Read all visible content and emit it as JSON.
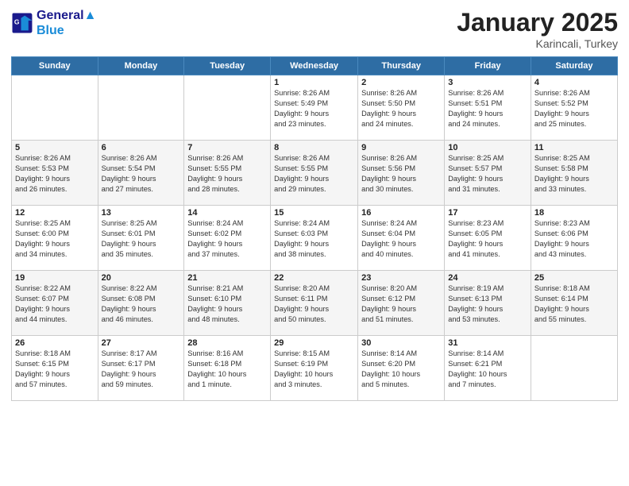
{
  "logo": {
    "line1": "General",
    "line2": "Blue"
  },
  "title": "January 2025",
  "location": "Karincali, Turkey",
  "days_header": [
    "Sunday",
    "Monday",
    "Tuesday",
    "Wednesday",
    "Thursday",
    "Friday",
    "Saturday"
  ],
  "weeks": [
    [
      {
        "num": "",
        "info": ""
      },
      {
        "num": "",
        "info": ""
      },
      {
        "num": "",
        "info": ""
      },
      {
        "num": "1",
        "info": "Sunrise: 8:26 AM\nSunset: 5:49 PM\nDaylight: 9 hours\nand 23 minutes."
      },
      {
        "num": "2",
        "info": "Sunrise: 8:26 AM\nSunset: 5:50 PM\nDaylight: 9 hours\nand 24 minutes."
      },
      {
        "num": "3",
        "info": "Sunrise: 8:26 AM\nSunset: 5:51 PM\nDaylight: 9 hours\nand 24 minutes."
      },
      {
        "num": "4",
        "info": "Sunrise: 8:26 AM\nSunset: 5:52 PM\nDaylight: 9 hours\nand 25 minutes."
      }
    ],
    [
      {
        "num": "5",
        "info": "Sunrise: 8:26 AM\nSunset: 5:53 PM\nDaylight: 9 hours\nand 26 minutes."
      },
      {
        "num": "6",
        "info": "Sunrise: 8:26 AM\nSunset: 5:54 PM\nDaylight: 9 hours\nand 27 minutes."
      },
      {
        "num": "7",
        "info": "Sunrise: 8:26 AM\nSunset: 5:55 PM\nDaylight: 9 hours\nand 28 minutes."
      },
      {
        "num": "8",
        "info": "Sunrise: 8:26 AM\nSunset: 5:55 PM\nDaylight: 9 hours\nand 29 minutes."
      },
      {
        "num": "9",
        "info": "Sunrise: 8:26 AM\nSunset: 5:56 PM\nDaylight: 9 hours\nand 30 minutes."
      },
      {
        "num": "10",
        "info": "Sunrise: 8:25 AM\nSunset: 5:57 PM\nDaylight: 9 hours\nand 31 minutes."
      },
      {
        "num": "11",
        "info": "Sunrise: 8:25 AM\nSunset: 5:58 PM\nDaylight: 9 hours\nand 33 minutes."
      }
    ],
    [
      {
        "num": "12",
        "info": "Sunrise: 8:25 AM\nSunset: 6:00 PM\nDaylight: 9 hours\nand 34 minutes."
      },
      {
        "num": "13",
        "info": "Sunrise: 8:25 AM\nSunset: 6:01 PM\nDaylight: 9 hours\nand 35 minutes."
      },
      {
        "num": "14",
        "info": "Sunrise: 8:24 AM\nSunset: 6:02 PM\nDaylight: 9 hours\nand 37 minutes."
      },
      {
        "num": "15",
        "info": "Sunrise: 8:24 AM\nSunset: 6:03 PM\nDaylight: 9 hours\nand 38 minutes."
      },
      {
        "num": "16",
        "info": "Sunrise: 8:24 AM\nSunset: 6:04 PM\nDaylight: 9 hours\nand 40 minutes."
      },
      {
        "num": "17",
        "info": "Sunrise: 8:23 AM\nSunset: 6:05 PM\nDaylight: 9 hours\nand 41 minutes."
      },
      {
        "num": "18",
        "info": "Sunrise: 8:23 AM\nSunset: 6:06 PM\nDaylight: 9 hours\nand 43 minutes."
      }
    ],
    [
      {
        "num": "19",
        "info": "Sunrise: 8:22 AM\nSunset: 6:07 PM\nDaylight: 9 hours\nand 44 minutes."
      },
      {
        "num": "20",
        "info": "Sunrise: 8:22 AM\nSunset: 6:08 PM\nDaylight: 9 hours\nand 46 minutes."
      },
      {
        "num": "21",
        "info": "Sunrise: 8:21 AM\nSunset: 6:10 PM\nDaylight: 9 hours\nand 48 minutes."
      },
      {
        "num": "22",
        "info": "Sunrise: 8:20 AM\nSunset: 6:11 PM\nDaylight: 9 hours\nand 50 minutes."
      },
      {
        "num": "23",
        "info": "Sunrise: 8:20 AM\nSunset: 6:12 PM\nDaylight: 9 hours\nand 51 minutes."
      },
      {
        "num": "24",
        "info": "Sunrise: 8:19 AM\nSunset: 6:13 PM\nDaylight: 9 hours\nand 53 minutes."
      },
      {
        "num": "25",
        "info": "Sunrise: 8:18 AM\nSunset: 6:14 PM\nDaylight: 9 hours\nand 55 minutes."
      }
    ],
    [
      {
        "num": "26",
        "info": "Sunrise: 8:18 AM\nSunset: 6:15 PM\nDaylight: 9 hours\nand 57 minutes."
      },
      {
        "num": "27",
        "info": "Sunrise: 8:17 AM\nSunset: 6:17 PM\nDaylight: 9 hours\nand 59 minutes."
      },
      {
        "num": "28",
        "info": "Sunrise: 8:16 AM\nSunset: 6:18 PM\nDaylight: 10 hours\nand 1 minute."
      },
      {
        "num": "29",
        "info": "Sunrise: 8:15 AM\nSunset: 6:19 PM\nDaylight: 10 hours\nand 3 minutes."
      },
      {
        "num": "30",
        "info": "Sunrise: 8:14 AM\nSunset: 6:20 PM\nDaylight: 10 hours\nand 5 minutes."
      },
      {
        "num": "31",
        "info": "Sunrise: 8:14 AM\nSunset: 6:21 PM\nDaylight: 10 hours\nand 7 minutes."
      },
      {
        "num": "",
        "info": ""
      }
    ]
  ]
}
